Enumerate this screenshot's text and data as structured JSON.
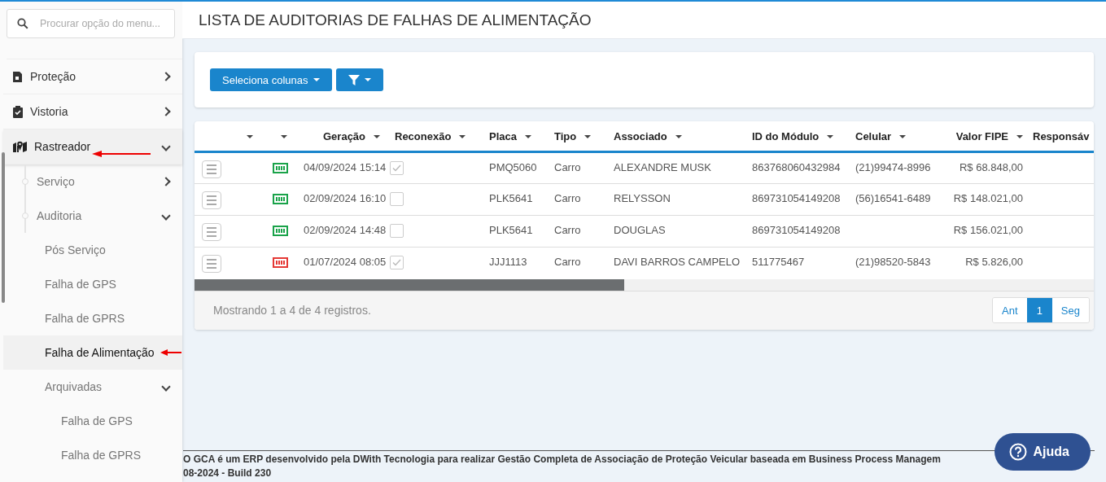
{
  "sidebar": {
    "search": {
      "placeholder": "Procurar opção do menu..."
    },
    "items": [
      {
        "label": "Proteção",
        "expanded": false,
        "selected": false
      },
      {
        "label": "Vistoria",
        "expanded": false,
        "selected": false
      },
      {
        "label": "Rastreador",
        "expanded": true,
        "selected": true,
        "children": [
          {
            "label": "Serviço",
            "expanded": false,
            "selected": false
          },
          {
            "label": "Auditoria",
            "expanded": true,
            "selected": false,
            "children": [
              {
                "label": "Pós Serviço",
                "selected": false
              },
              {
                "label": "Falha de GPS",
                "selected": false
              },
              {
                "label": "Falha de GPRS",
                "selected": false
              },
              {
                "label": "Falha de Alimentação",
                "selected": true
              },
              {
                "label": "Arquivadas",
                "expanded": true,
                "selected": false,
                "children": [
                  {
                    "label": "Falha de GPS",
                    "selected": false
                  },
                  {
                    "label": "Falha de GPRS",
                    "selected": false
                  }
                ]
              }
            ]
          }
        ]
      }
    ]
  },
  "page_title": "LISTA DE AUDITORIAS DE FALHAS DE ALIMENTAÇÃO",
  "toolbar": {
    "columns_button": "Seleciona colunas"
  },
  "table": {
    "columns": [
      {
        "sortable": true
      },
      {
        "sortable": true
      },
      {
        "label": "Geração",
        "sortable": true
      },
      {
        "label": "Reconexão",
        "sortable": true
      },
      {
        "label": "Placa",
        "sortable": true
      },
      {
        "label": "Tipo",
        "sortable": true
      },
      {
        "label": "Associado",
        "sortable": true
      },
      {
        "label": "ID do Módulo",
        "sortable": true
      },
      {
        "label": "Celular",
        "sortable": true
      },
      {
        "label": "Valor FIPE",
        "sortable": true
      },
      {
        "label": "Responsáv",
        "sortable": false
      }
    ],
    "rows": [
      {
        "color": "#1aa34a",
        "geracao": "04/09/2024 15:14",
        "reconexao": true,
        "placa": "PMQ5060",
        "tipo": "Carro",
        "associado": "ALEXANDRE MUSK",
        "id_modulo": "863768060432984",
        "celular": "(21)99474-8996",
        "valor_fipe": "R$ 68.848,00"
      },
      {
        "color": "#1aa34a",
        "geracao": "02/09/2024 16:10",
        "reconexao": false,
        "placa": "PLK5641",
        "tipo": "Carro",
        "associado": "RELYSSON",
        "id_modulo": "869731054149208",
        "celular": "(56)16541-6489",
        "valor_fipe": "R$ 148.021,00"
      },
      {
        "color": "#1aa34a",
        "geracao": "02/09/2024 14:48",
        "reconexao": false,
        "placa": "PLK5641",
        "tipo": "Carro",
        "associado": "DOUGLAS",
        "id_modulo": "869731054149208",
        "valor_fipe": "R$ 156.021,00"
      },
      {
        "color": "#e53935",
        "geracao": "01/07/2024 08:05",
        "reconexao": true,
        "placa": "JJJ1113",
        "tipo": "Carro",
        "associado": "DAVI BARROS CAMPELO",
        "id_modulo": "511775467",
        "celular": "(21)98520-5843",
        "valor_fipe": "R$ 5.826,00"
      }
    ],
    "summary": "Mostrando 1 a 4 de 4 registros.",
    "pagination": [
      {
        "label": "Ant",
        "selected": false
      },
      {
        "label": "1",
        "selected": true
      },
      {
        "label": "Seg",
        "selected": false
      }
    ]
  },
  "footer": {
    "line_1": "O GCA é um ERP desenvolvido pela DWith Tecnologia para realizar Gestão Completa de Associação de Proteção Veicular baseada em Business Process Managem",
    "line_2": "08-2024 - Build 230"
  },
  "help_button": "Ajuda"
}
